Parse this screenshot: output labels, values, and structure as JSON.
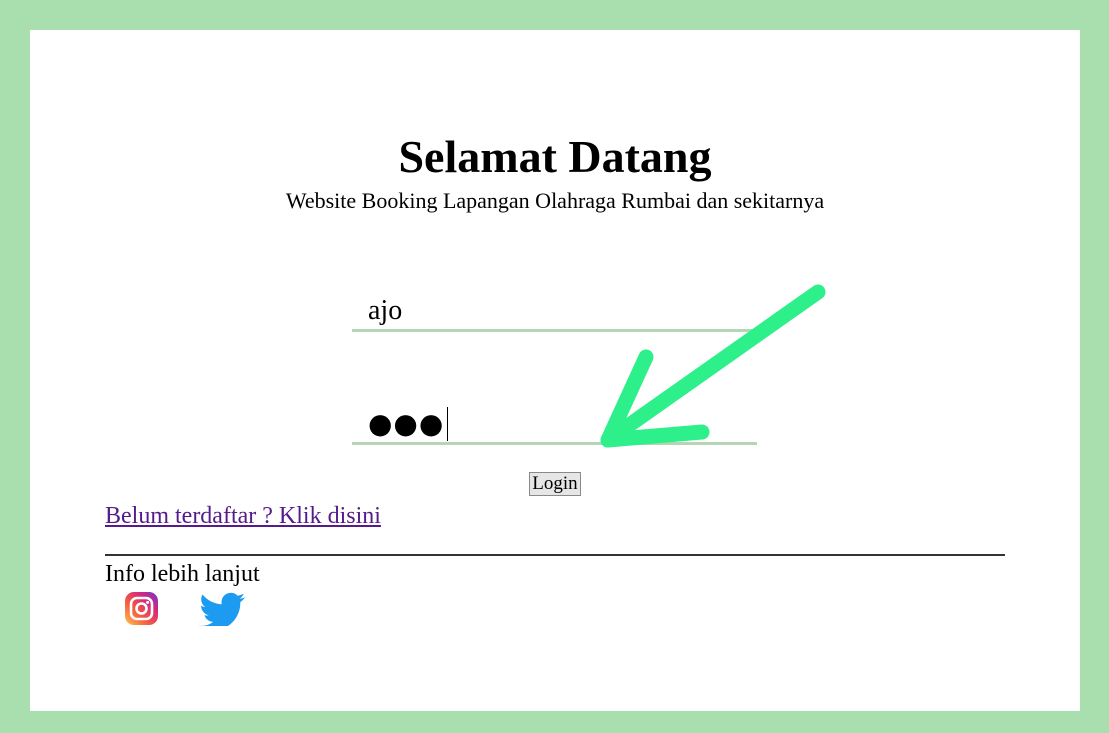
{
  "header": {
    "title": "Selamat Datang",
    "subtitle": "Website Booking Lapangan Olahraga Rumbai dan sekitarnya"
  },
  "form": {
    "username_value": "ajo",
    "password_masked": "●●●",
    "login_label": "Login"
  },
  "links": {
    "register": "Belum terdaftar ? Klik disini"
  },
  "footer": {
    "info_label": "Info lebih lanjut",
    "social_icons": [
      "instagram-icon",
      "twitter-icon"
    ]
  },
  "colors": {
    "frame": "#a9dfae",
    "field_underline": "#b6d4b6",
    "arrow": "#2ef08a",
    "link_visited": "#551a8b"
  }
}
